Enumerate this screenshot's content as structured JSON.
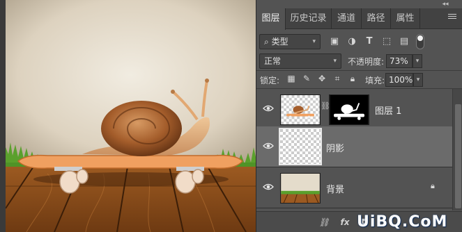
{
  "panel": {
    "tabs": [
      "图层",
      "历史记录",
      "通道",
      "路径",
      "属性"
    ],
    "active_tab": 0,
    "collapse_glyph": "◂◂",
    "filter": {
      "label": "类型",
      "icons": [
        "image-filter-icon",
        "adjustment-filter-icon",
        "type-filter-icon",
        "shape-filter-icon",
        "smart-object-filter-icon"
      ]
    },
    "blend_mode": "正常",
    "opacity": {
      "label": "不透明度:",
      "value": "73%"
    },
    "lock": {
      "label": "锁定:",
      "icons": [
        "lock-transparent-icon",
        "lock-image-icon",
        "lock-position-icon",
        "lock-artboard-icon",
        "lock-all-icon"
      ]
    },
    "fill": {
      "label": "填充:",
      "value": "100%"
    }
  },
  "layers": [
    {
      "name": "图层 1",
      "visible": true,
      "has_mask": true,
      "selected": false,
      "locked": false
    },
    {
      "name": "阴影",
      "visible": true,
      "has_mask": false,
      "selected": true,
      "locked": false
    },
    {
      "name": "背景",
      "visible": true,
      "has_mask": false,
      "selected": false,
      "locked": true
    }
  ],
  "footer": {
    "fx_label": "fx"
  },
  "watermark": "UiBQ.CoM",
  "colors": {
    "panel_bg": "#535353",
    "selected_row": "#6b6b6b",
    "tabbar_bg": "#424242"
  }
}
